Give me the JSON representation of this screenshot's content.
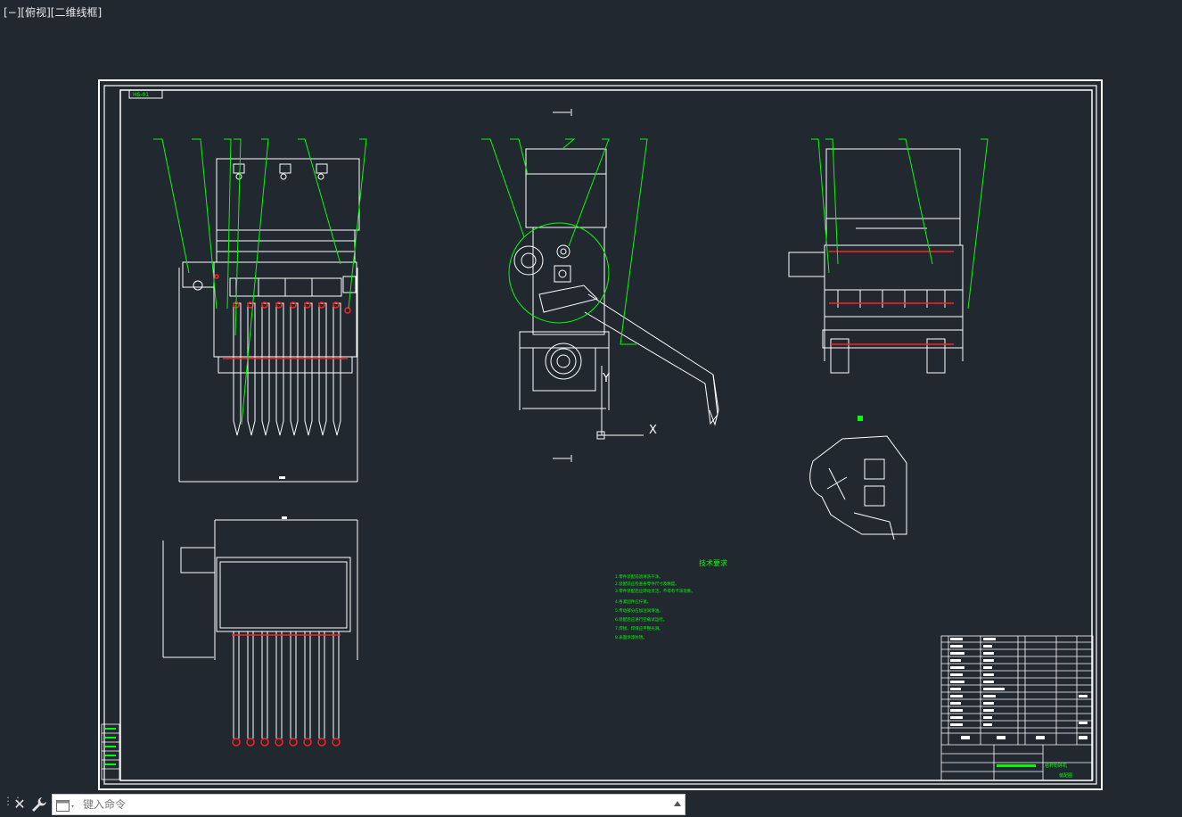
{
  "viewport": {
    "label": "[−][俯视][二维线框]"
  },
  "sheet": {
    "tag": "HS-01",
    "notes_title": "技术要求",
    "notes": [
      "1.零件装配前须清洗干净。",
      "2.装配前应检查各零件尺寸及精度。",
      "3.零件装配后应转动灵活，不得有卡滞现象。",
      "4.各紧固件应拧紧。",
      "5.传动部分应加注润滑油。",
      "6.装配后应进行空载试运行。",
      "7.焊接、焊缝应平整光滑。",
      "8.表面涂漆防锈。"
    ],
    "title_block": {
      "drawing_title": "秸秆粉碎机",
      "drawing_no": "装配图"
    }
  },
  "axes": {
    "x": "X",
    "y": "Y"
  },
  "colors": {
    "background": "#212830",
    "frame": "#ffffff",
    "leader": "#00ff00",
    "text_green": "#00ff00",
    "accent_red": "#ff2020"
  },
  "command": {
    "placeholder": "键入命令",
    "value": ""
  },
  "icons": {
    "close": "close-icon",
    "customize": "wrench-icon",
    "command": "command-line-icon",
    "grip": "grip-icon"
  }
}
